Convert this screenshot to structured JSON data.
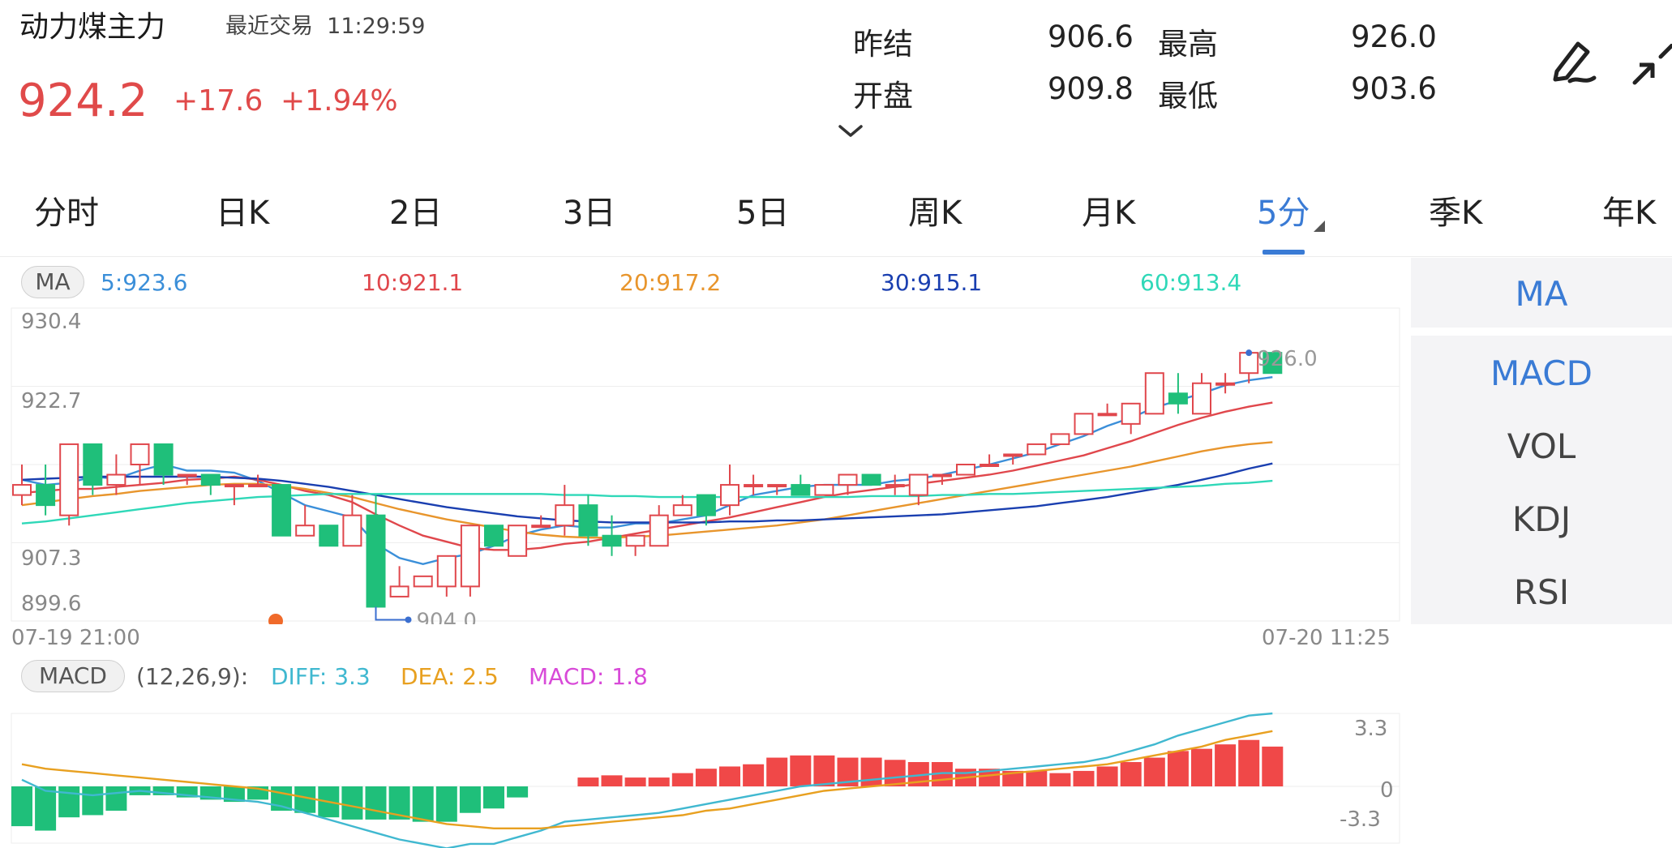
{
  "header": {
    "title": "动力煤主力",
    "recent_label": "最近交易",
    "recent_time": "11:29:59",
    "price": "924.2",
    "change": "+17.6",
    "change_pct": "+1.94%",
    "quote": {
      "prev_settle_label": "昨结",
      "prev_settle": "906.6",
      "high_label": "最高",
      "high": "926.0",
      "open_label": "开盘",
      "open": "909.8",
      "low_label": "最低",
      "low": "903.6"
    },
    "expand_glyph": "⌄",
    "icons": [
      "draw-icon",
      "collapse-icon"
    ]
  },
  "tabs": [
    {
      "label": "分时"
    },
    {
      "label": "日K"
    },
    {
      "label": "2日"
    },
    {
      "label": "3日"
    },
    {
      "label": "5日"
    },
    {
      "label": "周K"
    },
    {
      "label": "月K"
    },
    {
      "label": "5分",
      "active": true
    },
    {
      "label": "季K"
    },
    {
      "label": "年K"
    }
  ],
  "side_panel": {
    "top": "MA",
    "items": [
      "MACD",
      "VOL",
      "KDJ",
      "RSI"
    ]
  },
  "ma_legend": {
    "label": "MA",
    "values": [
      {
        "text": "5:923.6",
        "color": "#3b8fd9"
      },
      {
        "text": "10:921.1",
        "color": "#e0474c"
      },
      {
        "text": "20:917.2",
        "color": "#e8952c"
      },
      {
        "text": "30:915.1",
        "color": "#1a3fb0"
      },
      {
        "text": "60:913.4",
        "color": "#2fd8b8"
      }
    ]
  },
  "macd_legend": {
    "label": "MACD",
    "params": "(12,26,9):",
    "diff": "DIFF: 3.3",
    "dea": "DEA: 2.5",
    "macd": "MACD: 1.8",
    "diff_color": "#40b8d0",
    "dea_color": "#e8a020",
    "macd_color": "#d84ad8"
  },
  "axis": {
    "price_ticks": [
      "930.4",
      "922.7",
      "907.3",
      "899.6"
    ],
    "start_time": "07-19 21:00",
    "end_time": "07-20 11:25",
    "max_label": "926.0",
    "min_label": "904.0",
    "macd_ticks": [
      "3.3",
      "0",
      "-3.3"
    ]
  },
  "colors": {
    "up": "#e0474c",
    "down": "#1fbf7a",
    "accent": "#3a7bd5",
    "marker": "#f06a2a"
  },
  "chart_data": {
    "type": "candlestick",
    "ylim": [
      899.6,
      930.4
    ],
    "candles": [
      [
        912,
        913,
        915,
        911
      ],
      [
        913,
        911,
        915,
        910
      ],
      [
        910,
        917,
        917,
        909
      ],
      [
        917,
        913,
        917,
        912
      ],
      [
        913,
        914,
        916,
        912
      ],
      [
        915,
        917,
        917,
        913
      ],
      [
        917,
        914,
        917,
        913
      ],
      [
        914,
        914,
        914,
        913
      ],
      [
        914,
        913,
        914,
        912
      ],
      [
        913,
        913,
        913,
        911
      ],
      [
        913,
        913,
        914,
        913
      ],
      [
        913,
        908,
        913,
        908
      ],
      [
        908,
        909,
        911,
        908
      ],
      [
        909,
        907,
        909,
        907
      ],
      [
        907,
        910,
        912,
        907
      ],
      [
        910,
        901,
        912,
        901
      ],
      [
        902,
        903,
        905,
        902
      ],
      [
        903,
        904,
        904,
        903
      ],
      [
        903,
        906,
        906,
        902
      ],
      [
        903,
        909,
        909,
        902
      ],
      [
        909,
        907,
        909,
        907
      ],
      [
        906,
        909,
        909,
        906
      ],
      [
        909,
        909,
        910,
        909
      ],
      [
        909,
        911,
        913,
        908
      ],
      [
        911,
        908,
        912,
        907
      ],
      [
        908,
        907,
        910,
        906
      ],
      [
        907,
        908,
        908,
        906
      ],
      [
        907,
        910,
        911,
        907
      ],
      [
        910,
        911,
        912,
        910
      ],
      [
        912,
        910,
        912,
        909
      ],
      [
        911,
        913,
        915,
        910
      ],
      [
        913,
        913,
        914,
        912
      ],
      [
        913,
        913,
        913,
        912
      ],
      [
        913,
        912,
        914,
        912
      ],
      [
        912,
        913,
        913,
        912
      ],
      [
        913,
        914,
        914,
        912
      ],
      [
        914,
        913,
        914,
        913
      ],
      [
        913,
        913,
        914,
        912
      ],
      [
        912,
        914,
        914,
        911
      ],
      [
        914,
        914,
        914,
        913
      ],
      [
        914,
        915,
        915,
        914
      ],
      [
        915,
        915,
        916,
        915
      ],
      [
        916,
        916,
        916,
        915
      ],
      [
        916,
        917,
        917,
        916
      ],
      [
        917,
        918,
        918,
        917
      ],
      [
        918,
        920,
        920,
        918
      ],
      [
        920,
        920,
        921,
        920
      ],
      [
        919,
        921,
        921,
        918
      ],
      [
        920,
        924,
        924,
        920
      ],
      [
        922,
        921,
        924,
        920
      ],
      [
        920,
        923,
        924,
        920
      ],
      [
        923,
        923,
        924,
        922
      ],
      [
        924,
        926,
        926,
        923
      ],
      [
        926,
        924,
        926,
        924
      ]
    ],
    "ma": {
      "5": [
        913.5,
        913.0,
        913.2,
        913.8,
        913.6,
        914.4,
        915.0,
        914.4,
        914.4,
        914.2,
        913.4,
        912.2,
        911.0,
        910.4,
        909.8,
        907.2,
        905.8,
        905.2,
        905.8,
        906.2,
        907.0,
        908.0,
        908.6,
        909.0,
        908.8,
        908.8,
        909.2,
        909.2,
        909.6,
        910.0,
        911.0,
        912.0,
        912.4,
        912.8,
        913.0,
        913.0,
        913.0,
        913.4,
        913.6,
        914.0,
        914.5,
        915.0,
        915.6,
        916.2,
        917.0,
        917.8,
        918.8,
        919.6,
        920.6,
        921.3,
        922.0,
        922.8,
        923.3,
        923.6
      ],
      "10": [
        912.2,
        912.4,
        912.6,
        912.6,
        912.8,
        913.0,
        913.2,
        913.5,
        913.6,
        913.8,
        913.5,
        913.0,
        912.4,
        912.0,
        911.3,
        910.1,
        909.0,
        908.0,
        907.4,
        906.8,
        906.6,
        906.6,
        906.8,
        907.2,
        907.4,
        907.8,
        908.2,
        908.6,
        909.0,
        909.4,
        909.8,
        910.3,
        910.8,
        911.3,
        911.8,
        912.2,
        912.5,
        912.8,
        913.1,
        913.4,
        913.7,
        914.0,
        914.4,
        914.9,
        915.4,
        915.9,
        916.6,
        917.3,
        918.1,
        918.9,
        919.6,
        920.2,
        920.7,
        921.1
      ],
      "20": [
        911.0,
        911.3,
        911.6,
        911.9,
        912.1,
        912.4,
        912.6,
        912.8,
        913.0,
        913.1,
        913.1,
        912.9,
        912.6,
        912.2,
        911.8,
        911.2,
        910.6,
        910.1,
        909.6,
        909.2,
        908.8,
        908.4,
        908.1,
        907.9,
        907.8,
        907.8,
        907.9,
        908.0,
        908.2,
        908.4,
        908.6,
        908.8,
        909.0,
        909.3,
        909.6,
        910.0,
        910.4,
        910.8,
        911.2,
        911.6,
        912.0,
        912.4,
        912.8,
        913.2,
        913.6,
        914.0,
        914.4,
        914.8,
        915.3,
        915.8,
        916.3,
        916.7,
        917.0,
        917.2
      ],
      "30": [
        913.5,
        913.6,
        913.7,
        913.8,
        913.8,
        913.8,
        913.8,
        913.8,
        913.8,
        913.7,
        913.6,
        913.4,
        913.1,
        912.8,
        912.4,
        912.0,
        911.6,
        911.2,
        910.8,
        910.5,
        910.2,
        909.9,
        909.7,
        909.5,
        909.4,
        909.3,
        909.3,
        909.3,
        909.3,
        909.3,
        909.4,
        909.4,
        909.5,
        909.5,
        909.6,
        909.7,
        909.8,
        909.9,
        910.0,
        910.1,
        910.3,
        910.5,
        910.7,
        910.9,
        911.2,
        911.5,
        911.8,
        912.2,
        912.6,
        913.0,
        913.5,
        914.0,
        914.6,
        915.1
      ],
      "60": [
        909.2,
        909.4,
        909.7,
        910.0,
        910.3,
        910.6,
        910.9,
        911.2,
        911.4,
        911.6,
        911.8,
        911.9,
        912.0,
        912.1,
        912.1,
        912.1,
        912.1,
        912.1,
        912.1,
        912.1,
        912.1,
        912.1,
        912.1,
        912.0,
        912.0,
        911.9,
        911.9,
        911.8,
        911.8,
        911.8,
        911.8,
        911.8,
        911.8,
        911.8,
        911.8,
        911.8,
        911.9,
        911.9,
        911.9,
        912.0,
        912.0,
        912.1,
        912.1,
        912.2,
        912.3,
        912.4,
        912.5,
        912.6,
        912.7,
        912.8,
        912.9,
        913.1,
        913.2,
        913.4
      ]
    },
    "macd": {
      "ylim": [
        -3.3,
        3.3
      ],
      "hist": [
        -1.8,
        -2.0,
        -1.4,
        -1.3,
        -1.1,
        -0.4,
        -0.4,
        -0.5,
        -0.6,
        -0.7,
        -0.6,
        -1.1,
        -1.2,
        -1.4,
        -1.5,
        -1.5,
        -1.5,
        -1.6,
        -1.6,
        -1.2,
        -1.0,
        -0.5,
        0,
        0,
        0.4,
        0.5,
        0.4,
        0.4,
        0.6,
        0.8,
        0.9,
        1.0,
        1.3,
        1.4,
        1.4,
        1.3,
        1.3,
        1.2,
        1.1,
        1.1,
        0.8,
        0.8,
        0.7,
        0.7,
        0.6,
        0.7,
        0.9,
        1.1,
        1.3,
        1.6,
        1.7,
        1.9,
        2.1,
        1.8
      ],
      "diff": [
        0.3,
        -0.2,
        -0.3,
        -0.4,
        -0.3,
        -0.2,
        -0.3,
        -0.4,
        -0.5,
        -0.6,
        -0.7,
        -0.9,
        -1.2,
        -1.5,
        -1.8,
        -2.1,
        -2.4,
        -2.6,
        -2.8,
        -2.6,
        -2.6,
        -2.3,
        -2.0,
        -1.6,
        -1.5,
        -1.4,
        -1.3,
        -1.2,
        -1.0,
        -0.8,
        -0.6,
        -0.4,
        -0.2,
        0,
        0.1,
        0.2,
        0.3,
        0.4,
        0.5,
        0.6,
        0.6,
        0.7,
        0.8,
        0.9,
        1.0,
        1.1,
        1.3,
        1.6,
        1.9,
        2.3,
        2.6,
        2.9,
        3.2,
        3.3
      ],
      "dea": [
        1.0,
        0.8,
        0.7,
        0.6,
        0.5,
        0.4,
        0.3,
        0.2,
        0.1,
        0,
        -0.1,
        -0.3,
        -0.5,
        -0.7,
        -0.9,
        -1.1,
        -1.3,
        -1.5,
        -1.7,
        -1.8,
        -1.9,
        -1.9,
        -1.9,
        -1.8,
        -1.7,
        -1.6,
        -1.5,
        -1.4,
        -1.3,
        -1.1,
        -1.0,
        -0.8,
        -0.6,
        -0.4,
        -0.2,
        -0.1,
        0,
        0.1,
        0.2,
        0.3,
        0.4,
        0.5,
        0.6,
        0.7,
        0.8,
        0.9,
        1.0,
        1.2,
        1.4,
        1.6,
        1.8,
        2.1,
        2.3,
        2.5
      ]
    }
  }
}
